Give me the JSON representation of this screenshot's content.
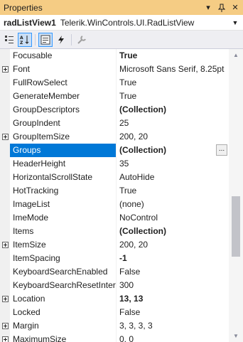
{
  "panel": {
    "title": "Properties",
    "pin_icon": "pin-icon",
    "close_icon": "close-icon"
  },
  "object_selector": {
    "name": "radListView1",
    "type": "Telerik.WinControls.UI.RadListView"
  },
  "toolbar": {
    "buttons": [
      "categorized-icon",
      "alphabetical-icon",
      "properties-icon",
      "events-icon",
      "property-pages-icon"
    ]
  },
  "properties": [
    {
      "name": "Focusable",
      "value": "True",
      "bold": true,
      "expandable": false
    },
    {
      "name": "Font",
      "value": "Microsoft Sans Serif, 8.25pt",
      "bold": false,
      "expandable": true
    },
    {
      "name": "FullRowSelect",
      "value": "True",
      "bold": false,
      "expandable": false
    },
    {
      "name": "GenerateMember",
      "value": "True",
      "bold": false,
      "expandable": false
    },
    {
      "name": "GroupDescriptors",
      "value": "(Collection)",
      "bold": true,
      "expandable": false
    },
    {
      "name": "GroupIndent",
      "value": "25",
      "bold": false,
      "expandable": false
    },
    {
      "name": "GroupItemSize",
      "value": "200, 20",
      "bold": false,
      "expandable": true
    },
    {
      "name": "Groups",
      "value": "(Collection)",
      "bold": true,
      "expandable": false,
      "selected": true,
      "ellipsis": "..."
    },
    {
      "name": "HeaderHeight",
      "value": "35",
      "bold": false,
      "expandable": false
    },
    {
      "name": "HorizontalScrollState",
      "value": "AutoHide",
      "bold": false,
      "expandable": false
    },
    {
      "name": "HotTracking",
      "value": "True",
      "bold": false,
      "expandable": false
    },
    {
      "name": "ImageList",
      "value": "(none)",
      "bold": false,
      "expandable": false
    },
    {
      "name": "ImeMode",
      "value": "NoControl",
      "bold": false,
      "expandable": false
    },
    {
      "name": "Items",
      "value": "(Collection)",
      "bold": true,
      "expandable": false
    },
    {
      "name": "ItemSize",
      "value": "200, 20",
      "bold": false,
      "expandable": true
    },
    {
      "name": "ItemSpacing",
      "value": "-1",
      "bold": true,
      "expandable": false
    },
    {
      "name": "KeyboardSearchEnabled",
      "value": "False",
      "bold": false,
      "expandable": false
    },
    {
      "name": "KeyboardSearchResetInterv",
      "value": "300",
      "bold": false,
      "expandable": false
    },
    {
      "name": "Location",
      "value": "13, 13",
      "bold": true,
      "expandable": true
    },
    {
      "name": "Locked",
      "value": "False",
      "bold": false,
      "expandable": false
    },
    {
      "name": "Margin",
      "value": "3, 3, 3, 3",
      "bold": false,
      "expandable": true
    },
    {
      "name": "MaximumSize",
      "value": "0, 0",
      "bold": false,
      "expandable": true
    }
  ],
  "colors": {
    "title_bar": "#f5cc84",
    "selection": "#0078d7"
  }
}
